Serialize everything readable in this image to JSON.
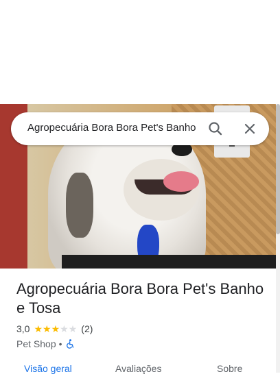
{
  "search": {
    "query": "Agropecuária Bora Bora Pet's Banho"
  },
  "place": {
    "title": "Agropecuária Bora Bora Pet's Banho e Tosa",
    "rating_value": "3,0",
    "rating_stars": 3,
    "rating_max": 5,
    "review_count": "(2)",
    "category": "Pet Shop",
    "separator": "•",
    "accessibility_icon": "wheelchair-icon"
  },
  "tabs": [
    {
      "label": "Visão geral",
      "active": true
    },
    {
      "label": "Avaliações",
      "active": false
    },
    {
      "label": "Sobre",
      "active": false
    }
  ],
  "colors": {
    "accent": "#1a73e8",
    "star": "#fbbc04",
    "star_empty": "#dadce0",
    "text": "#202124"
  }
}
